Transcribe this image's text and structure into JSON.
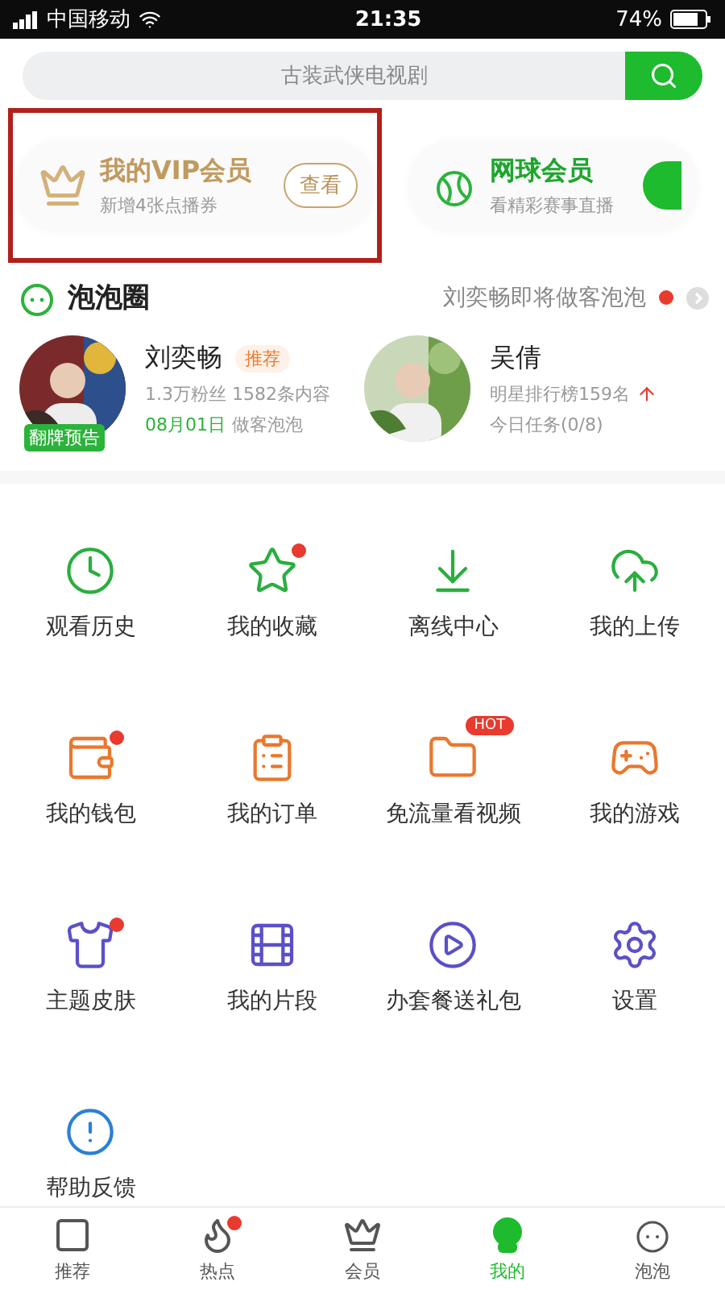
{
  "status_bar": {
    "carrier": "中国移动",
    "time": "21:35",
    "battery": "74%"
  },
  "search": {
    "placeholder": "古装武侠电视剧"
  },
  "vip_cards": [
    {
      "kind": "vip",
      "title": "我的VIP会员",
      "subtitle": "新增4张点播券",
      "button": "查看",
      "highlighted": true
    },
    {
      "kind": "tennis",
      "title": "网球会员",
      "subtitle": "看精彩赛事直播",
      "highlighted": false
    }
  ],
  "circle": {
    "title": "泡泡圈",
    "notice": "刘奕畅即将做客泡泡",
    "unread": true
  },
  "stars": [
    {
      "name": "刘奕畅",
      "tag": "推荐",
      "badge": "翻牌预告",
      "line1": "1.3万粉丝 1582条内容",
      "date": "08月01日",
      "line2": "做客泡泡",
      "rising": false
    },
    {
      "name": "吴倩",
      "line1": "明星排行榜159名",
      "line2": "今日任务(0/8)",
      "rising": true
    }
  ],
  "grid": [
    {
      "kind": "clock",
      "label": "观看历史",
      "color": "#2aae3e",
      "dot": false
    },
    {
      "kind": "star",
      "label": "我的收藏",
      "color": "#2aae3e",
      "dot": true
    },
    {
      "kind": "download",
      "label": "离线中心",
      "color": "#2aae3e",
      "dot": false
    },
    {
      "kind": "upload",
      "label": "我的上传",
      "color": "#2aae3e",
      "dot": false
    },
    {
      "kind": "wallet",
      "label": "我的钱包",
      "color": "#e8782e",
      "dot": true
    },
    {
      "kind": "order",
      "label": "我的订单",
      "color": "#e8782e",
      "dot": false
    },
    {
      "kind": "folder",
      "label": "免流量看视频",
      "color": "#e8782e",
      "dot": false,
      "tag": "HOT"
    },
    {
      "kind": "game",
      "label": "我的游戏",
      "color": "#e8782e",
      "dot": false
    },
    {
      "kind": "shirt",
      "label": "主题皮肤",
      "color": "#5a50c8",
      "dot": true
    },
    {
      "kind": "film",
      "label": "我的片段",
      "color": "#5a50c8",
      "dot": false
    },
    {
      "kind": "play",
      "label": "办套餐送礼包",
      "color": "#5a50c8",
      "dot": false
    },
    {
      "kind": "gear",
      "label": "设置",
      "color": "#5a50c8",
      "dot": false
    },
    {
      "kind": "help",
      "label": "帮助反馈",
      "color": "#2a80d4",
      "dot": false
    }
  ],
  "tabs": [
    {
      "kind": "home",
      "label": "推荐",
      "selected": false,
      "dot": false
    },
    {
      "kind": "hot",
      "label": "热点",
      "selected": false,
      "dot": true
    },
    {
      "kind": "vip",
      "label": "会员",
      "selected": false,
      "dot": false
    },
    {
      "kind": "me",
      "label": "我的",
      "selected": true,
      "dot": false
    },
    {
      "kind": "bubble",
      "label": "泡泡",
      "selected": false,
      "dot": false
    }
  ]
}
